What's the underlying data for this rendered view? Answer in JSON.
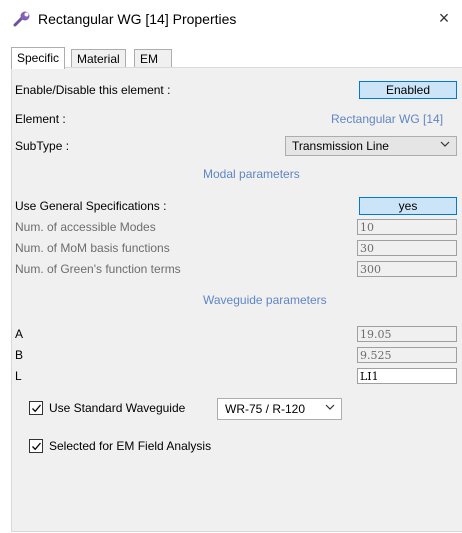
{
  "window": {
    "title": "Rectangular WG [14] Properties",
    "close_glyph": "×",
    "icon": "wrench-icon"
  },
  "tabs": [
    {
      "label": "Specific",
      "active": true
    },
    {
      "label": "Material",
      "active": false
    },
    {
      "label": "EM Field",
      "active": false
    }
  ],
  "specific": {
    "enable_label": "Enable/Disable this element :",
    "enable_value": "Enabled",
    "element_label": "Element :",
    "element_value": "Rectangular WG [14]",
    "subtype_label": "SubType :",
    "subtype_value": "Transmission Line",
    "modal_heading": "Modal parameters",
    "use_general_label": "Use General Specifications :",
    "use_general_value": "yes",
    "modes_label": "Num. of accessible Modes",
    "modes_value": "10",
    "mom_label": "Num. of MoM basis functions",
    "mom_value": "30",
    "green_label": "Num. of Green's function terms",
    "green_value": "300",
    "waveguide_heading": "Waveguide parameters",
    "a_label": "A",
    "a_value": "19.05",
    "b_label": "B",
    "b_value": "9.525",
    "l_label": "L",
    "l_value": "LI1",
    "std_wg_label": "Use Standard Waveguide",
    "std_wg_checked": true,
    "std_wg_value": "WR-75 / R-120",
    "em_analysis_label": "Selected for EM Field Analysis",
    "em_analysis_checked": true
  },
  "colors": {
    "accent_blue_text": "#5f86c6",
    "toggle_fill": "#cce4f7",
    "toggle_border": "#0078d7",
    "panel_bg": "#f0f0f0"
  }
}
